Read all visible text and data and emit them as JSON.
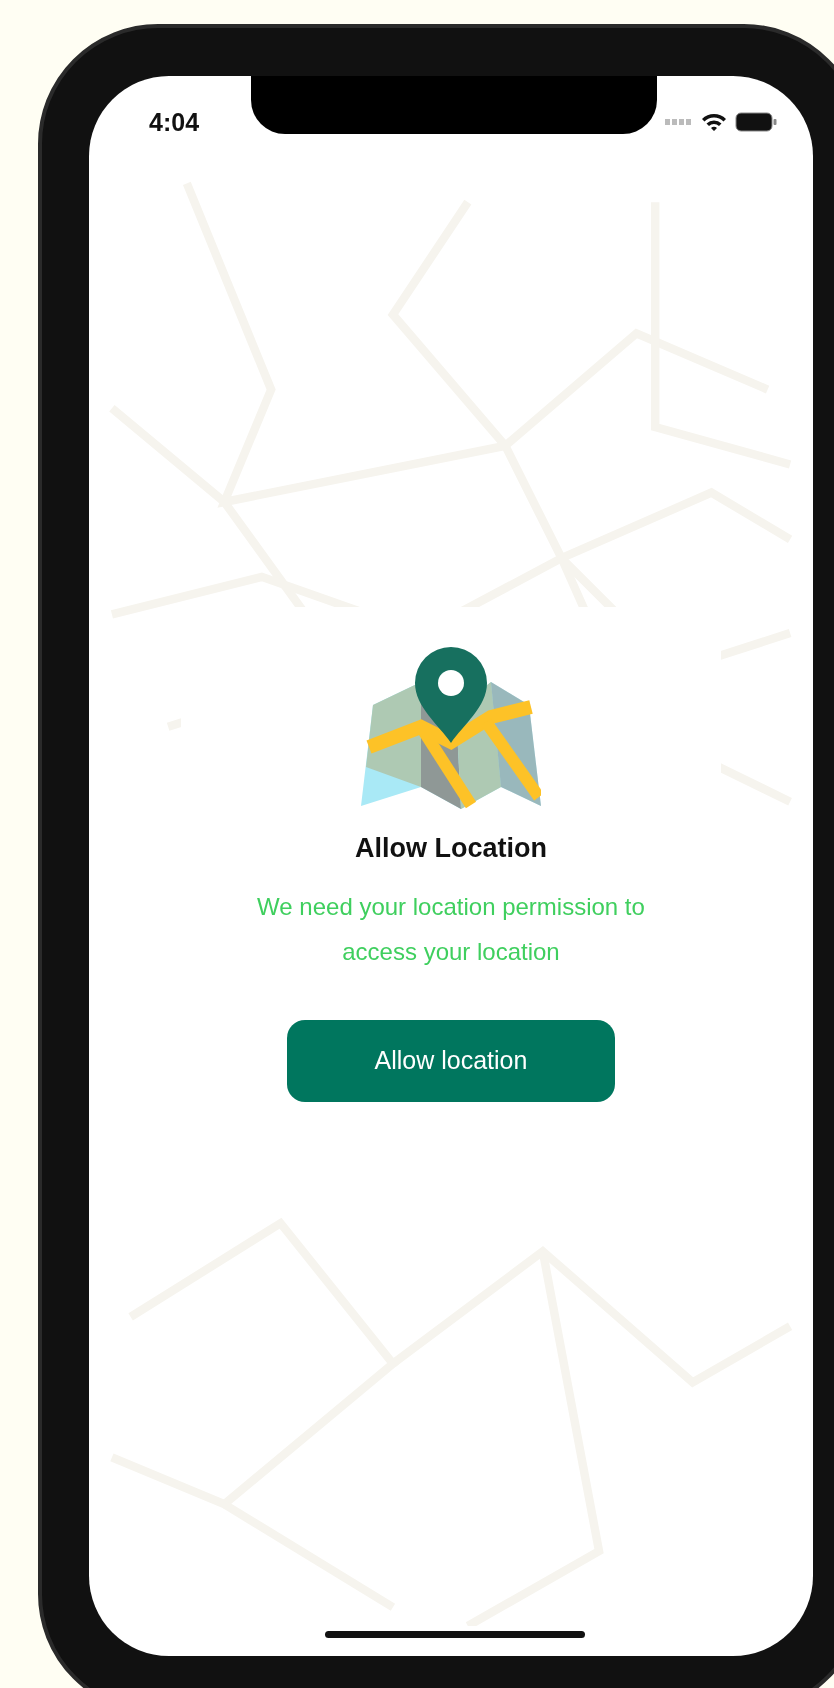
{
  "status_bar": {
    "time": "4:04"
  },
  "permission": {
    "title": "Allow Location",
    "description": "We need your location permission to access your location",
    "button": "Allow location"
  }
}
